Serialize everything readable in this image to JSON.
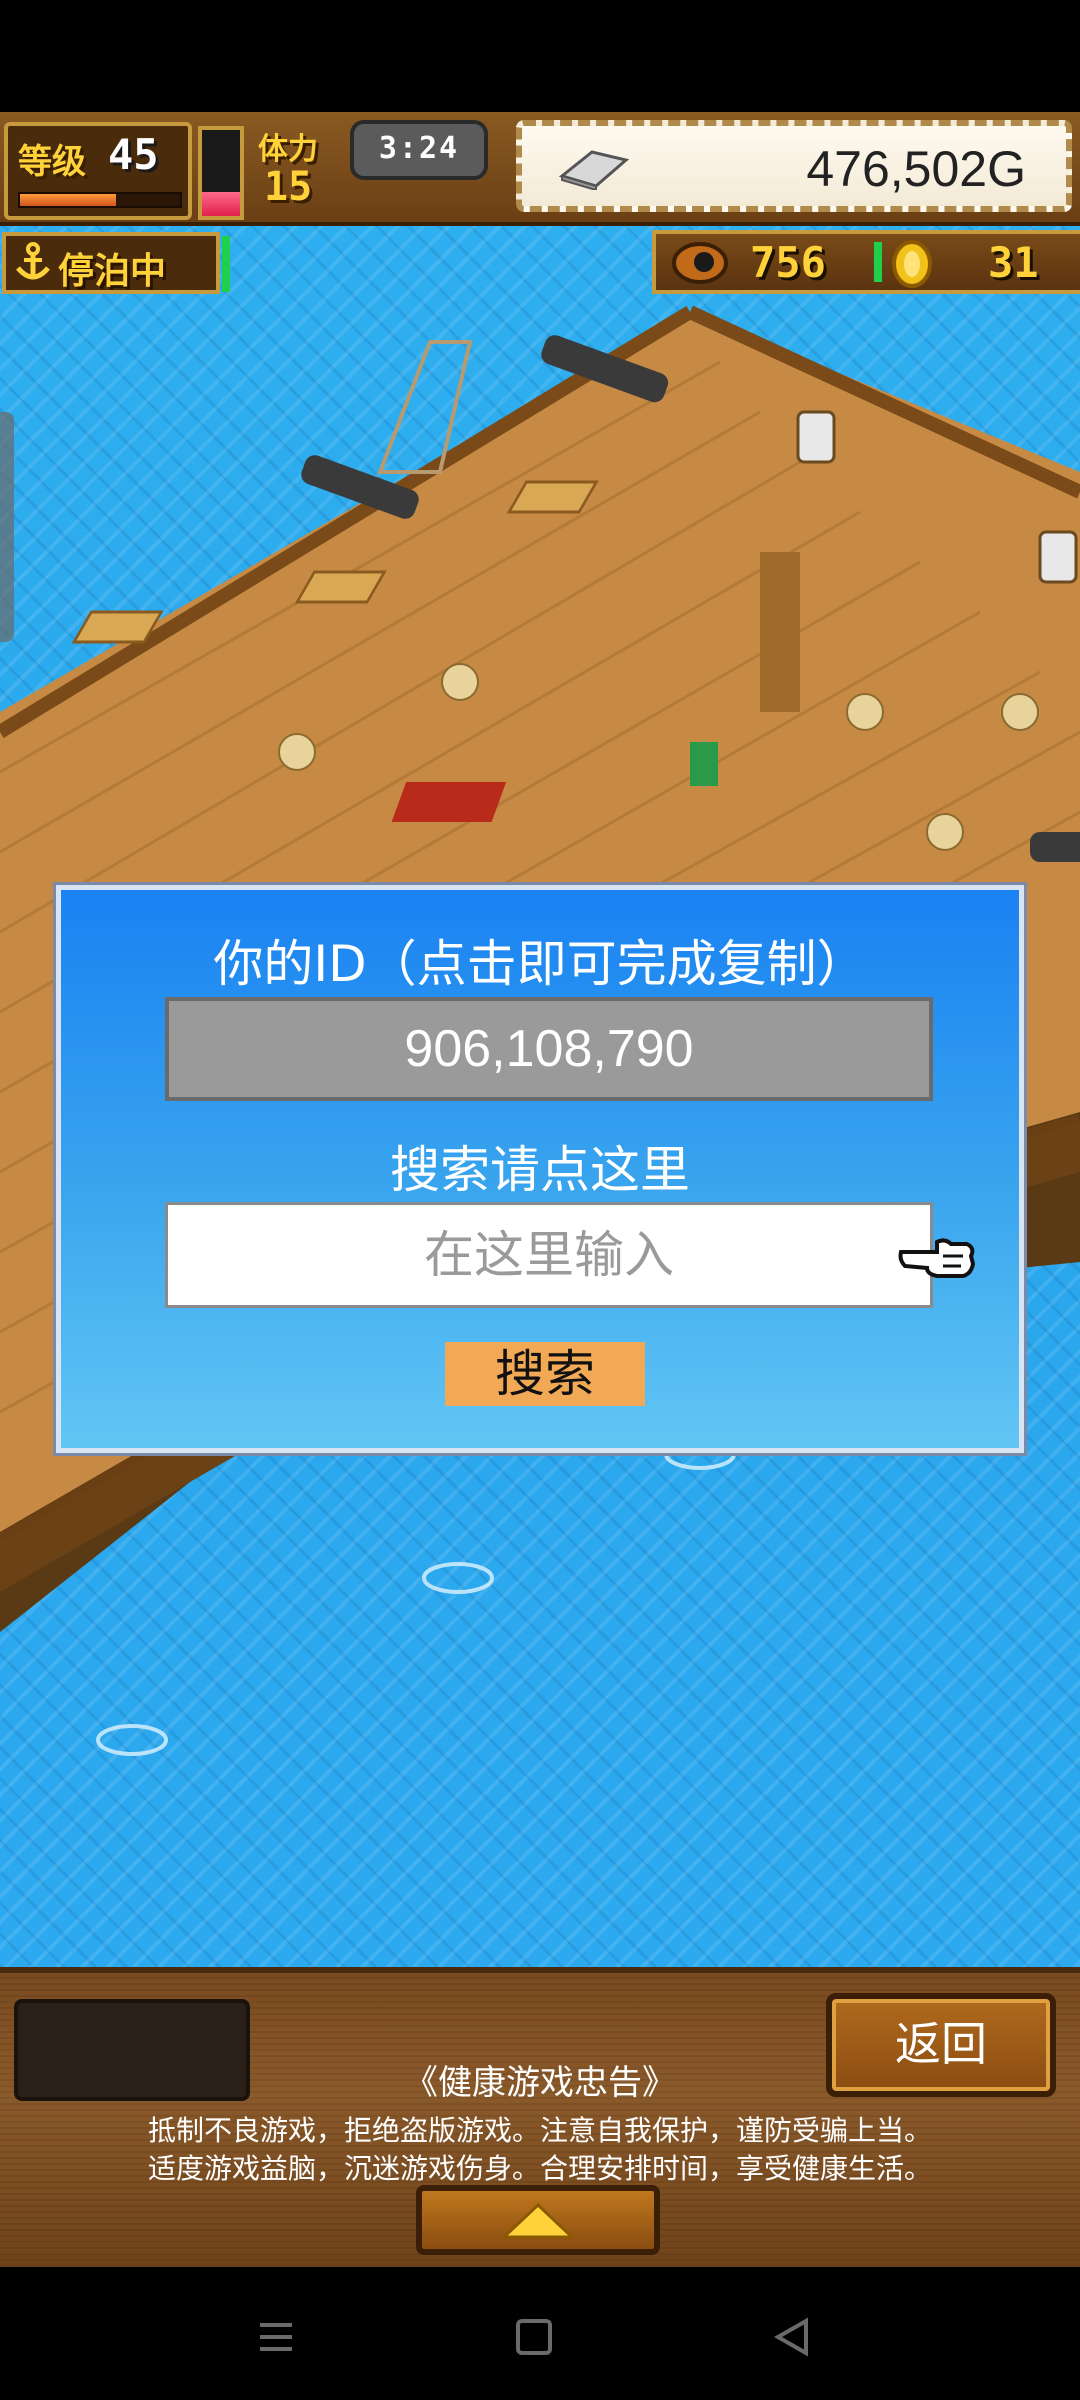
{
  "hud": {
    "level_label": "等级",
    "level_value": "45",
    "xp_progress": 0.6,
    "stamina_progress": 0.28,
    "stamina_label": "体力",
    "stamina_value": "15",
    "timer": "3:24",
    "gold": "476,502G"
  },
  "status": {
    "mooring_label": "停泊中",
    "cannonballs": "756",
    "medals": "31"
  },
  "dialog": {
    "title": "你的ID（点击即可完成复制）",
    "player_id": "906,108,790",
    "search_hint": "搜索请点这里",
    "input_placeholder": "在这里输入",
    "search_button": "搜索"
  },
  "footer": {
    "back_button": "返回",
    "notice_title": "《健康游戏忠告》",
    "notice_line1": "抵制不良游戏，拒绝盗版游戏。注意自我保护，谨防受骗上当。",
    "notice_line2": "适度游戏益脑，沉迷游戏伤身。合理安排时间，享受健康生活。"
  },
  "icons": {
    "anchor": "anchor-icon",
    "ingot": "silver-ingot-icon",
    "cannonball": "cannonball-icon",
    "medal": "gold-medal-icon",
    "hand": "pointing-hand-icon",
    "expand": "up-arrow-icon"
  },
  "colors": {
    "dialog_top": "#1a82f2",
    "dialog_bottom": "#62c6f4",
    "hud_text": "#ffd23a",
    "search_button_bg": "#f2a955",
    "sea": "#2aa6ec"
  }
}
